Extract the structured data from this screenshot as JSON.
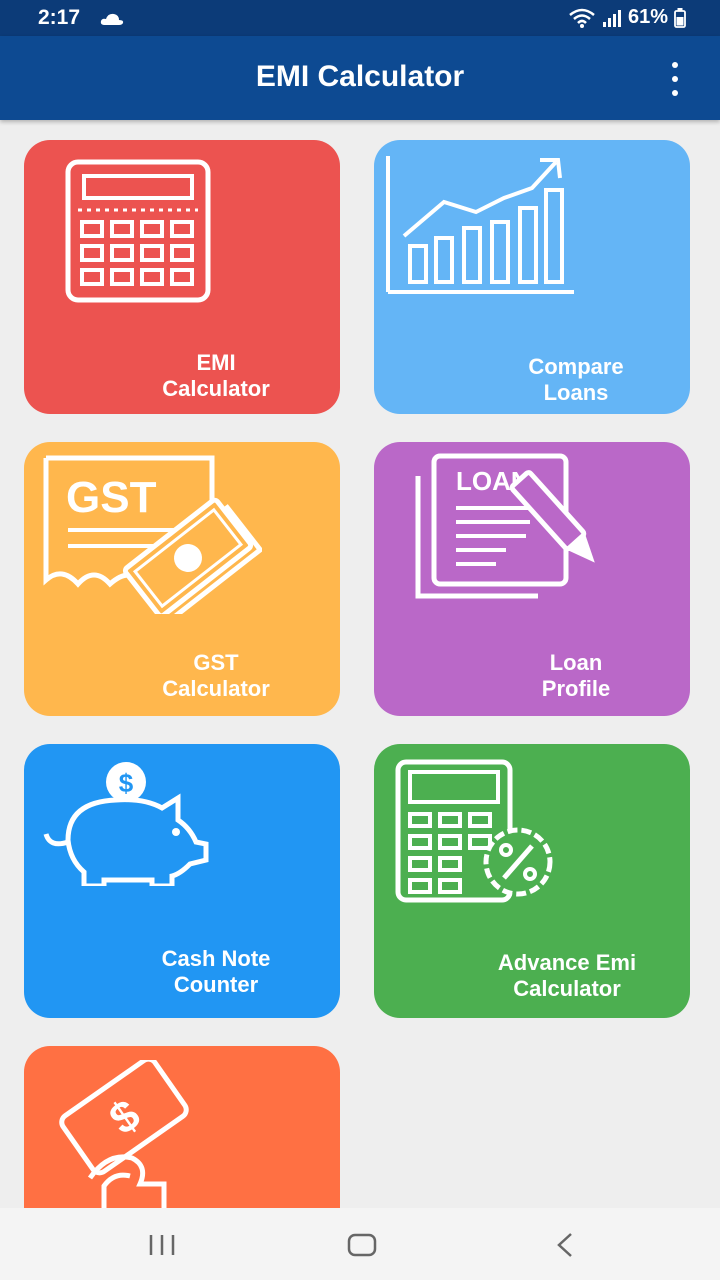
{
  "status_bar": {
    "time": "2:17",
    "battery": "61%"
  },
  "app_bar": {
    "title": "EMI Calculator"
  },
  "tiles": [
    {
      "line1": "EMI",
      "line2": "Calculator",
      "color": "#ec5350",
      "icon": "calculator-icon"
    },
    {
      "line1": "Compare",
      "line2": "Loans",
      "color": "#64b5f6",
      "icon": "bar-chart-icon"
    },
    {
      "line1": "GST",
      "line2": "Calculator",
      "color": "#ffb74d",
      "icon": "gst-receipt-icon"
    },
    {
      "line1": "Loan",
      "line2": "Profile",
      "color": "#ba68c8",
      "icon": "loan-document-icon",
      "icon_text": "LOAN"
    },
    {
      "line1": "Cash Note",
      "line2": "Counter",
      "color": "#2196f3",
      "icon": "piggy-bank-icon"
    },
    {
      "line1": "Advance Emi",
      "line2": "Calculator",
      "color": "#4caf50",
      "icon": "percent-calculator-icon"
    },
    {
      "line1": "",
      "line2": "",
      "color": "#ff7043",
      "icon": "money-hand-icon"
    }
  ],
  "gst_icon_text": "GST",
  "colors": {
    "status_bar": "#0c3b78",
    "app_bar": "#0d4a92",
    "background": "#eeeeee"
  }
}
